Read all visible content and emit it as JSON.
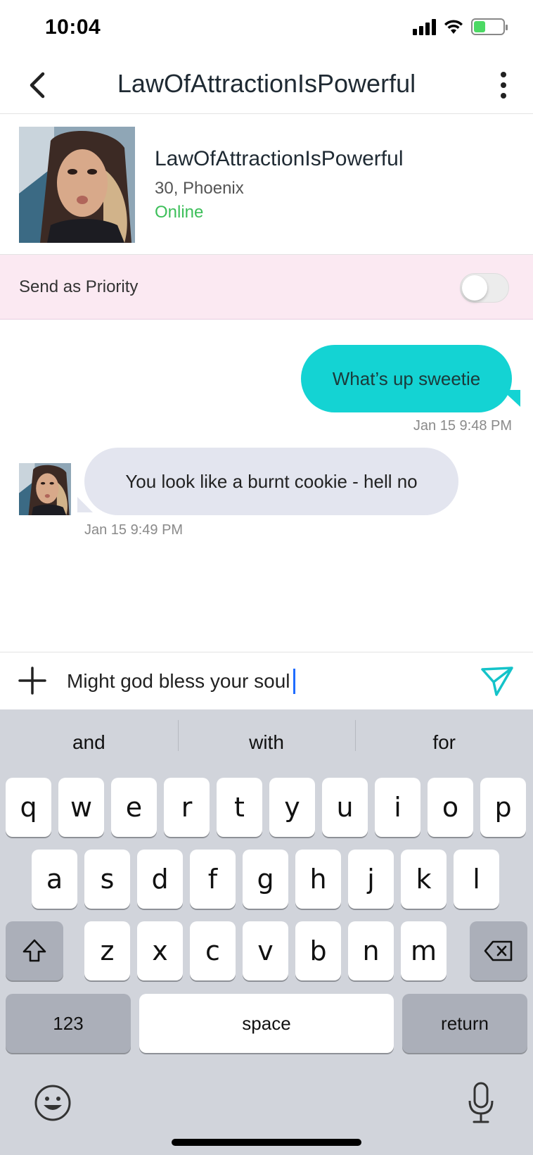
{
  "status_bar": {
    "time": "10:04"
  },
  "nav": {
    "title": "LawOfAttractionIsPowerful",
    "back_icon": "chevron-left-icon",
    "more_icon": "more-vertical-icon"
  },
  "profile": {
    "name": "LawOfAttractionIsPowerful",
    "meta": "30, Phoenix",
    "status": "Online"
  },
  "priority": {
    "label": "Send as Priority",
    "enabled": false
  },
  "messages": [
    {
      "direction": "outgoing",
      "text": "What’s up sweetie",
      "time": "Jan 15 9:48 PM"
    },
    {
      "direction": "incoming",
      "text": "You look like a burnt cookie - hell no",
      "time": "Jan 15 9:49 PM"
    }
  ],
  "composer": {
    "value": "Might god bless your soul",
    "add_icon": "plus-icon",
    "send_icon": "send-icon"
  },
  "keyboard": {
    "suggestions": [
      "and",
      "with",
      "for"
    ],
    "row1": [
      "q",
      "w",
      "e",
      "r",
      "t",
      "y",
      "u",
      "i",
      "o",
      "p"
    ],
    "row2": [
      "a",
      "s",
      "d",
      "f",
      "g",
      "h",
      "j",
      "k",
      "l"
    ],
    "row3": [
      "z",
      "x",
      "c",
      "v",
      "b",
      "n",
      "m"
    ],
    "numbers_label": "123",
    "space_label": "space",
    "return_label": "return"
  },
  "colors": {
    "accent_teal": "#14d3d3",
    "online_green": "#3dbf5a",
    "priority_bg": "#fbe9f2",
    "incoming_bubble": "#e3e5ef"
  }
}
